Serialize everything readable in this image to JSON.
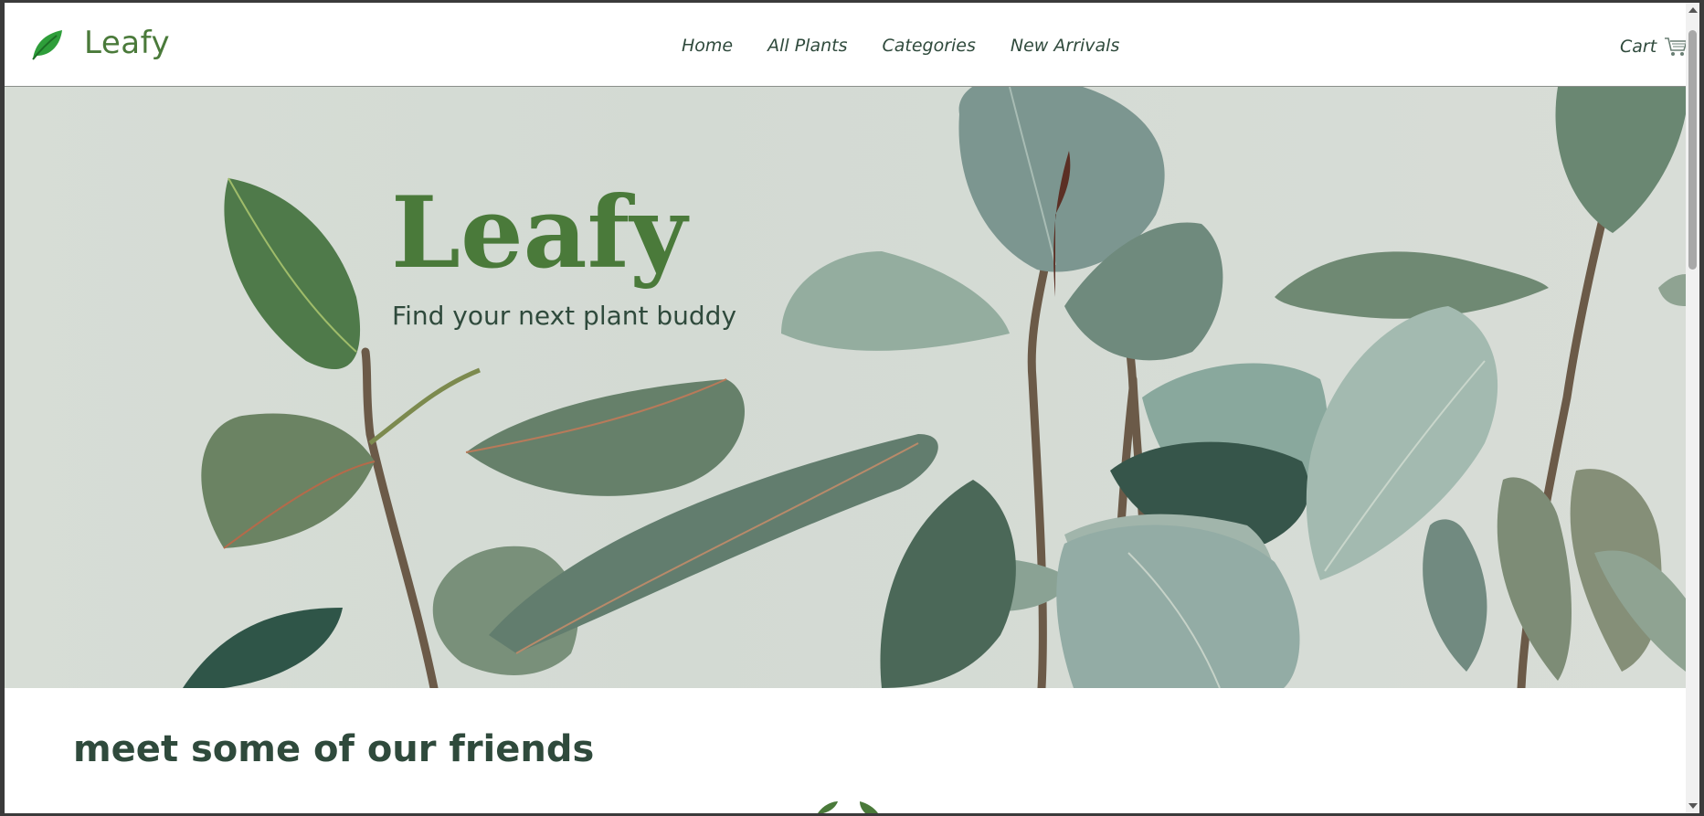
{
  "header": {
    "brand": "Leafy",
    "logo_icon": "leaf-icon",
    "nav": [
      {
        "label": "Home"
      },
      {
        "label": "All Plants"
      },
      {
        "label": "Categories"
      },
      {
        "label": "New Arrivals"
      }
    ],
    "cart": {
      "label": "Cart",
      "icon": "cart-icon"
    }
  },
  "hero": {
    "title": "Leafy",
    "subtitle": "Find your next plant buddy",
    "image": "rubber plant leaves on pale green background"
  },
  "section": {
    "title": "meet some of our friends"
  },
  "colors": {
    "brand_green": "#4a7a3a",
    "text_dark": "#2f4a3c",
    "hero_bg": "#d5dbd4",
    "leaf_icon": "#2e9e3a"
  }
}
